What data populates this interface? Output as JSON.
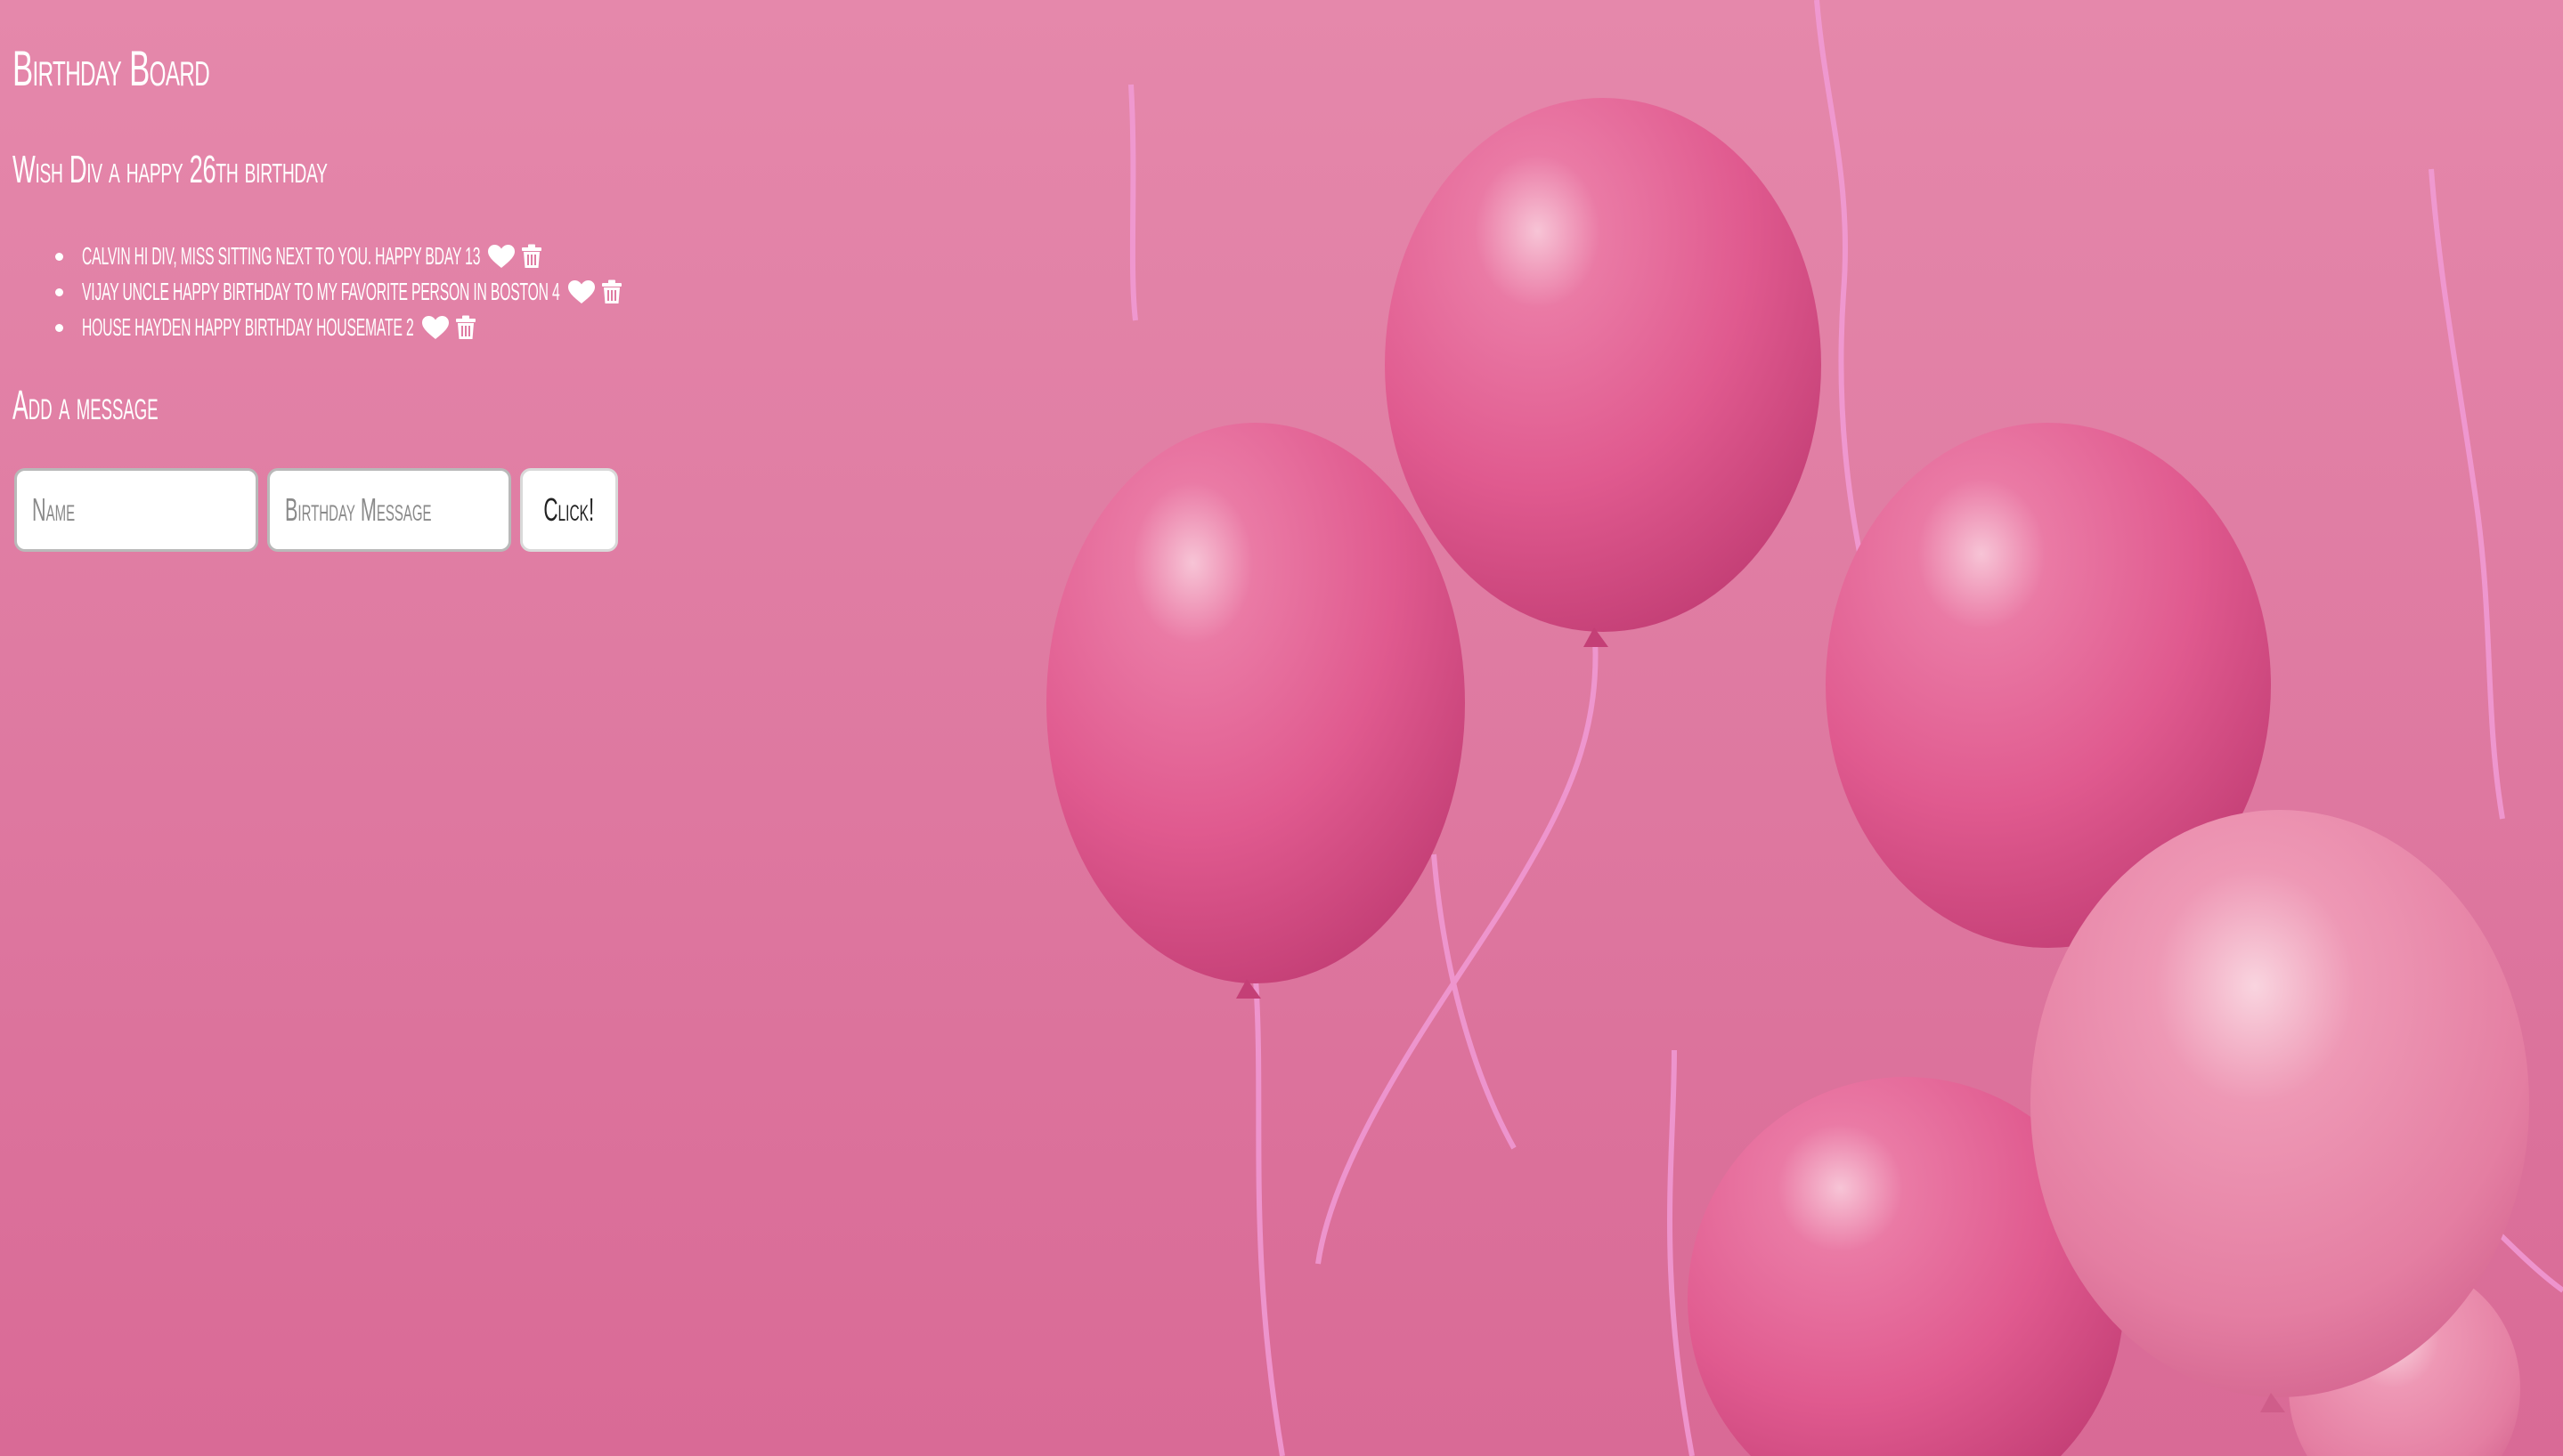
{
  "page": {
    "title": "Birthday Board",
    "subtitle": "Wish Div a happy 26th birthday"
  },
  "messages": [
    {
      "name": "Calvin",
      "text": "hi div, miss sitting next to you. happy bday",
      "likes": "13"
    },
    {
      "name": "Vijay Uncle",
      "text": "Happy birthday to my favorite person in boston",
      "likes": "4"
    },
    {
      "name": "House Hayden",
      "text": "happy birthday housemate",
      "likes": "2"
    }
  ],
  "form": {
    "heading": "Add a message",
    "name_placeholder": "Name",
    "message_placeholder": "Birthday Message",
    "submit_label": "Click!"
  },
  "icons": {
    "like": "heart-icon",
    "delete": "trash-icon"
  },
  "colors": {
    "background_top": "#e588ab",
    "background_bottom": "#d96a96",
    "text": "#ffffff",
    "balloon": "#e2578f"
  }
}
